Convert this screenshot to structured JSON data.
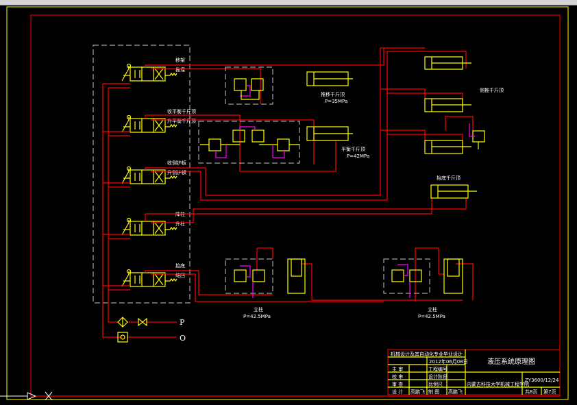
{
  "colors": {
    "background": "#000000",
    "pipe": "#ff0000",
    "component": "#ffff00",
    "pilot": "#ff00ff",
    "frame": "#ffff00",
    "boundary": "#c8c8c8"
  },
  "valves": [
    {
      "top_label": "移架",
      "bottom_label": "推溜"
    },
    {
      "top_label": "收平衡千斤顶",
      "bottom_label": "升平衡千斤顶"
    },
    {
      "top_label": "收侧护板",
      "bottom_label": "升侧护板"
    },
    {
      "top_label": "降柱",
      "bottom_label": "升柱"
    },
    {
      "top_label": "抬底",
      "bottom_label": "缩回"
    }
  ],
  "ports": {
    "pressure": "P",
    "return": "O"
  },
  "cylinders": {
    "push": {
      "label": "推移千斤顶",
      "pressure": "P=35MPa"
    },
    "balance": {
      "label": "平衡千斤顶",
      "pressure": "P=42MPa"
    },
    "side": {
      "label": "侧推千斤顶"
    },
    "base": {
      "label": "抬底千斤顶"
    },
    "prop1": {
      "label": "立柱",
      "pressure": "P=42.5MPa"
    },
    "prop2": {
      "label": "立柱",
      "pressure": "P=42.5MPa"
    }
  },
  "title_block": {
    "project": "机械设计及其自动化专业毕业设计",
    "date": "2012年06月08日",
    "drawing_title": "液压系统原理图",
    "institution": "内蒙古科技大学机械工程学院",
    "drawing_no": "ZY3600/12/24",
    "total_pages": "共8页",
    "page": "第7页",
    "rows": [
      {
        "role": "主 审",
        "name": "",
        "field": "工程编号",
        "value": ""
      },
      {
        "role": "校 审",
        "name": "",
        "field": "设计阶段",
        "value": ""
      },
      {
        "role": "审 查",
        "name": "",
        "field": "比例尺",
        "value": ""
      },
      {
        "role": "设 计",
        "name": "高鹏飞",
        "field": "制 图",
        "value": "高鹏飞"
      }
    ]
  }
}
